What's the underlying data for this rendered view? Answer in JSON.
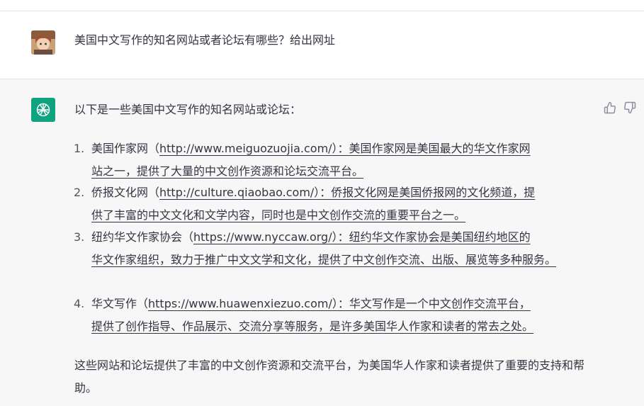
{
  "conversation": {
    "user_message": "美国中文写作的知名网站或者论坛有哪些？给出网址",
    "assistant": {
      "intro": "以下是一些美国中文写作的知名网站或论坛：",
      "items": [
        {
          "num": "1.",
          "name": "美国作家网（",
          "url": "http://www.meiguozuojia.com/",
          "desc_line1": "）：美国作家网是美国最大的华文作家网",
          "desc_rest": "站之一，提供了大量的中文创作资源和论坛交流平台。"
        },
        {
          "num": "2.",
          "name": "侨报文化网（",
          "url": "http://culture.qiaobao.com/",
          "desc_line1": "）：侨报文化网是美国侨报网的文化频道，提",
          "desc_rest": "供了丰富的中文文化和文学内容，同时也是中文创作交流的重要平台之一。"
        },
        {
          "num": "3.",
          "name": "纽约华文作家协会（",
          "url": "https://www.nyccaw.org/",
          "desc_line1": "）：纽约华文作家协会是美国纽约地区的",
          "desc_rest": "华文作家组织，致力于推广中文文学和文化，提供了中文创作交流、出版、展览等多种服务。"
        },
        {
          "num": "4.",
          "name": "华文写作（",
          "url": "https://www.huawenxiezuo.com/",
          "desc_line1": "）：华文写作是一个中文创作交流平台，",
          "desc_rest": "提供了创作指导、作品展示、交流分享等服务，是许多美国华人作家和读者的常去之处。"
        }
      ],
      "conclusion": "这些网站和论坛提供了丰富的中文创作资源和交流平台，为美国华人作家和读者提供了重要的支持和帮助。"
    }
  },
  "colors": {
    "bot_avatar_bg": "#10a37f",
    "assistant_row_bg": "#f7f7f8"
  },
  "icons": {
    "thumbs_up": "thumbs-up-icon",
    "thumbs_down": "thumbs-down-icon",
    "bot": "openai-logo-icon"
  }
}
